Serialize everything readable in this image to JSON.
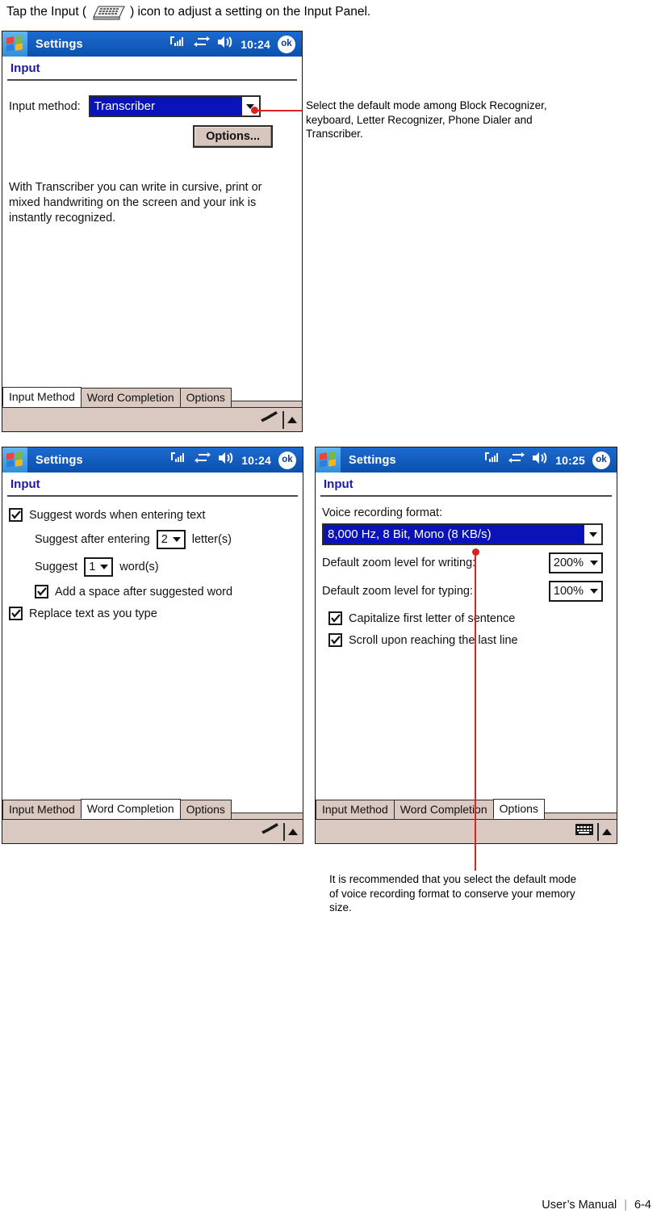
{
  "intro": {
    "before": "Tap the Input (",
    "icon": "keyboard-icon",
    "after": ") icon to adjust a setting on the Input Panel."
  },
  "screen1": {
    "titlebar": {
      "start_icon": "windows-flag-icon",
      "title": "Settings",
      "signal_icon": "signal-bars-icon",
      "connection_icon": "connectivity-icon",
      "volume_icon": "speaker-icon",
      "clock": "10:24",
      "ok_label": "ok"
    },
    "page_title": "Input",
    "input_method_label": "Input method:",
    "input_method_value": "Transcriber",
    "options_button": "Options...",
    "description": "With Transcriber you can write in cursive, print or mixed handwriting on the screen and your ink is instantly recognized.",
    "tabs": [
      {
        "label": "Input Method",
        "active": true
      },
      {
        "label": "Word Completion",
        "active": false
      },
      {
        "label": "Options",
        "active": false
      }
    ],
    "sip_icon": "handwriting-pen-icon",
    "sip_arrow_icon": "chevron-up-icon"
  },
  "annotation1": "Select the default mode among Block Recognizer, keyboard, Letter Recognizer, Phone Dialer and Transcriber.",
  "screen2": {
    "titlebar": {
      "start_icon": "windows-flag-icon",
      "title": "Settings",
      "signal_icon": "signal-bars-icon",
      "connection_icon": "connectivity-icon",
      "volume_icon": "speaker-icon",
      "clock": "10:24",
      "ok_label": "ok"
    },
    "page_title": "Input",
    "options": {
      "suggest_words": {
        "label": "Suggest words when entering text",
        "checked": true
      },
      "suggest_after_prefix": "Suggest after entering",
      "suggest_after_value": "2",
      "suggest_after_suffix": "letter(s)",
      "suggest_count_prefix": "Suggest",
      "suggest_count_value": "1",
      "suggest_count_suffix": "word(s)",
      "add_space": {
        "label": "Add a space after suggested word",
        "checked": true
      },
      "replace_text": {
        "label": "Replace text as you type",
        "checked": true
      }
    },
    "tabs": [
      {
        "label": "Input Method",
        "active": false
      },
      {
        "label": "Word Completion",
        "active": true
      },
      {
        "label": "Options",
        "active": false
      }
    ],
    "sip_icon": "handwriting-pen-icon",
    "sip_arrow_icon": "chevron-up-icon"
  },
  "screen3": {
    "titlebar": {
      "start_icon": "windows-flag-icon",
      "title": "Settings",
      "signal_icon": "signal-bars-icon",
      "connection_icon": "connectivity-icon",
      "volume_icon": "speaker-icon",
      "clock": "10:25",
      "ok_label": "ok"
    },
    "page_title": "Input",
    "options": {
      "voice_format_label": "Voice recording format:",
      "voice_format_value": "8,000 Hz, 8 Bit, Mono (8 KB/s)",
      "zoom_writing_label": "Default zoom level for writing:",
      "zoom_writing_value": "200%",
      "zoom_typing_label": "Default zoom level for typing:",
      "zoom_typing_value": "100%",
      "capitalize": {
        "label": "Capitalize first letter of sentence",
        "checked": true
      },
      "scroll_last_line": {
        "label": "Scroll upon reaching the last line",
        "checked": true
      }
    },
    "tabs": [
      {
        "label": "Input Method",
        "active": false
      },
      {
        "label": "Word Completion",
        "active": false
      },
      {
        "label": "Options",
        "active": true
      }
    ],
    "sip_icon": "keyboard-icon",
    "sip_arrow_icon": "chevron-up-icon"
  },
  "annotation2": "It is recommended that you select the default mode of voice recording format to conserve your memory size.",
  "footer": {
    "manual": "User’s Manual",
    "separator": "|",
    "page": "6-4"
  },
  "colors": {
    "titlebar_blue": "#1560bd",
    "accent_red": "#e02020",
    "tab_tan": "#d9c9c0",
    "header_navy": "#1c1c9c",
    "select_blue": "#0a13b8"
  }
}
